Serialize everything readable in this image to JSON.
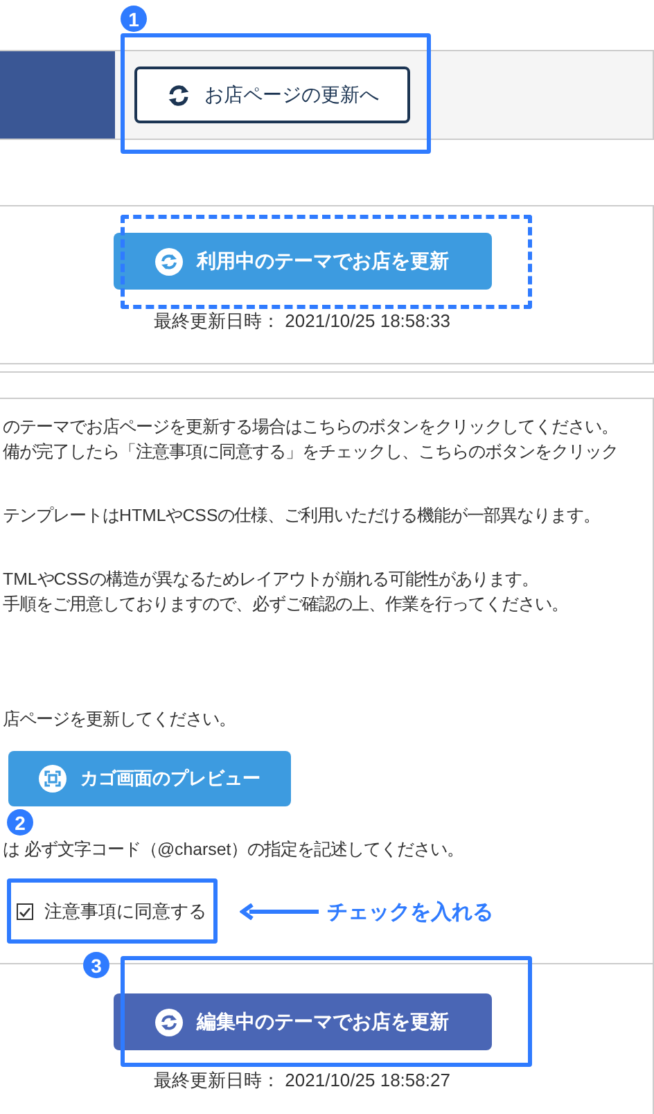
{
  "header": {
    "button": "お店ページの更新へ"
  },
  "current_theme": {
    "button": "利用中のテーマでお店を更新",
    "last_updated": "最終更新日時： 2021/10/25 18:58:33"
  },
  "instructions": [
    [
      "のテーマでお店ページを更新する場合はこちらのボタンをクリックしてください。",
      "備が完了したら「注意事項に同意する」をチェックし、こちらのボタンをクリック"
    ],
    [
      "テンプレートはHTMLやCSSの仕様、ご利用いただける機能が一部異なります。"
    ],
    [
      "TMLやCSSの構造が異なるためレイアウトが崩れる可能性があります。",
      "手順をご用意しておりますので、必ずご確認の上、作業を行ってください。"
    ],
    [
      "店ページを更新してください。"
    ]
  ],
  "preview_button": "カゴ画面のプレビュー",
  "charset_note": "は 必ず文字コード（@charset）の指定を記述してください。",
  "agree": {
    "label": "注意事項に同意する",
    "checked": true
  },
  "editing_theme": {
    "button": "編集中のテーマでお店を更新",
    "last_updated": "最終更新日時： 2021/10/25 18:58:27"
  },
  "annotations": {
    "badges": [
      "1",
      "2",
      "3"
    ],
    "note": "チェックを入れる"
  }
}
